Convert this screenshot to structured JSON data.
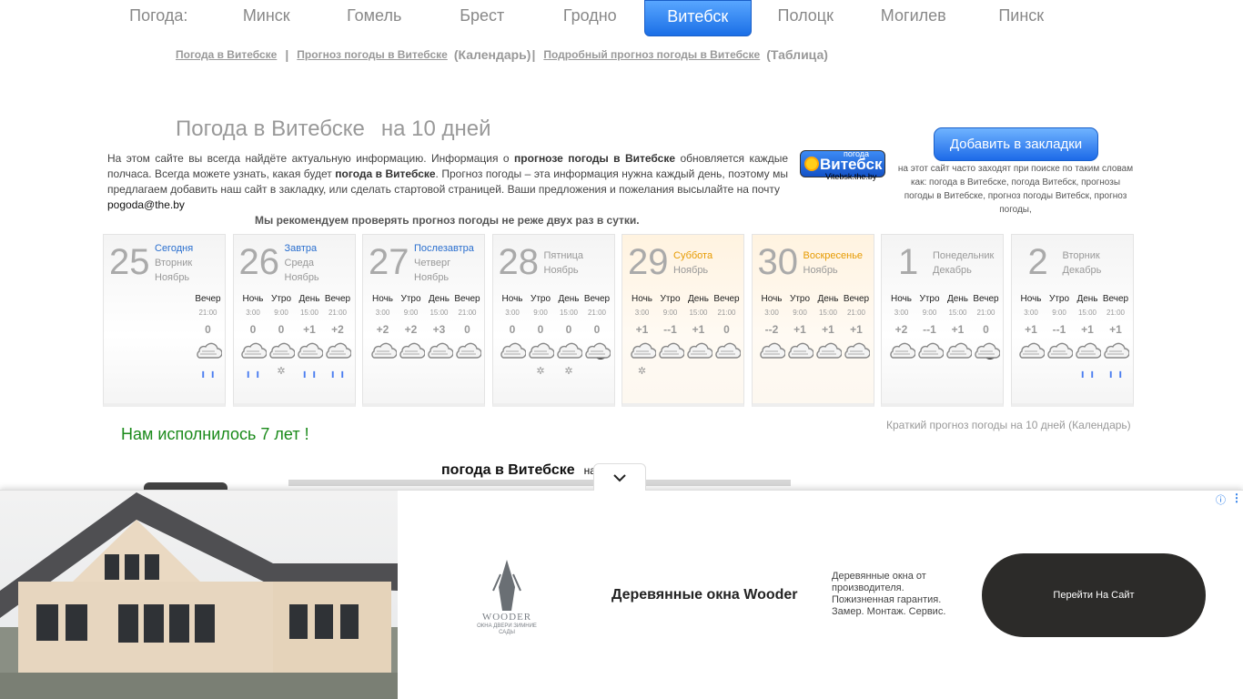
{
  "nav": {
    "label": "Погода:",
    "cities": [
      "Минск",
      "Гомель",
      "Брест",
      "Гродно",
      "Витебск",
      "Полоцк",
      "Могилев",
      "Пинск"
    ],
    "active": "Витебск"
  },
  "sublinks": {
    "link1": "Погода в Витебске",
    "sep1": "|",
    "link2": "Прогноз погоды в Витебске",
    "paren2": "(Календарь)",
    "sep2": "|",
    "link3": "Подробный прогноз погоды в Витебске",
    "paren3": "(Таблица)"
  },
  "heading": {
    "title": "Погода в Витебске",
    "period": "на 10 дней"
  },
  "intro": {
    "p1": "На этом сайте вы всегда найдёте актуальную информацию. Информация о ",
    "b1": "прогнозе погоды в Витебске",
    "p2": " обновляется каждые полчаса. Всегда можете узнать, какая будет ",
    "b2": "погода в Витебске",
    "p3": ". Прогноз погоды – эта информация нужна каждый день, поэтому мы предлагаем добавить наш сайт в закладку, или сделать стартовой страницей. Ваши предложения и пожелания высылайте на почту",
    "email": "pogoda@the.by",
    "recommend": "Мы рекомендуем проверять прогноз погоды не реже двух раз в сутки."
  },
  "logo": {
    "top": "погода",
    "city": "Витебск",
    "domain": "Vitebsk.the.by"
  },
  "bookmark_label": "Добавить в закладки",
  "search_tags": "на этот сайт часто заходят при поиске по таким словам как: погода в Витебске, погода Витебск, прогнозы погоды в Витебске, прогноз погоды Витебск, прогноз погоды,",
  "periods": [
    "Ночь",
    "Утро",
    "День",
    "Вечер"
  ],
  "hours": [
    "3:00",
    "9:00",
    "15:00",
    "21:00"
  ],
  "days": [
    {
      "num": "25",
      "l1": "Сегодня",
      "l2": "Вторник",
      "l3": "Ноябрь",
      "type": "link",
      "cols": [
        {
          "p": "Вечер",
          "h": "21:00",
          "t": "0",
          "icon": "cloud",
          "pr": "rain"
        }
      ]
    },
    {
      "num": "26",
      "l1": "Завтра",
      "l2": "Среда",
      "l3": "Ноябрь",
      "type": "link",
      "cols": [
        {
          "p": "Ночь",
          "h": "3:00",
          "t": "0",
          "icon": "cloud",
          "pr": "rain"
        },
        {
          "p": "Утро",
          "h": "9:00",
          "t": "0",
          "icon": "cloud",
          "pr": "snow"
        },
        {
          "p": "День",
          "h": "15:00",
          "t": "+1",
          "icon": "cloud",
          "pr": "rain"
        },
        {
          "p": "Вечер",
          "h": "21:00",
          "t": "+2",
          "icon": "cloud",
          "pr": "rain"
        }
      ]
    },
    {
      "num": "27",
      "l1": "Послезавтра",
      "l2": "Четверг",
      "l3": "Ноябрь",
      "type": "link",
      "cols": [
        {
          "p": "Ночь",
          "h": "3:00",
          "t": "+2",
          "icon": "cloud",
          "pr": ""
        },
        {
          "p": "Утро",
          "h": "9:00",
          "t": "+2",
          "icon": "cloud",
          "pr": ""
        },
        {
          "p": "День",
          "h": "15:00",
          "t": "+3",
          "icon": "cloud",
          "pr": ""
        },
        {
          "p": "Вечер",
          "h": "21:00",
          "t": "0",
          "icon": "cloud",
          "pr": ""
        }
      ]
    },
    {
      "num": "28",
      "l1": "",
      "l2": "Пятница",
      "l3": "Ноябрь",
      "type": "plain",
      "cols": [
        {
          "p": "Ночь",
          "h": "3:00",
          "t": "0",
          "icon": "cloud",
          "pr": ""
        },
        {
          "p": "Утро",
          "h": "9:00",
          "t": "0",
          "icon": "cloud",
          "pr": "snow"
        },
        {
          "p": "День",
          "h": "15:00",
          "t": "0",
          "icon": "suncloud",
          "pr": "snow"
        },
        {
          "p": "Вечер",
          "h": "21:00",
          "t": "0",
          "icon": "mooncloud",
          "pr": ""
        }
      ]
    },
    {
      "num": "29",
      "l1": "",
      "l2": "Суббота",
      "l3": "Ноябрь",
      "type": "weekend",
      "cols": [
        {
          "p": "Ночь",
          "h": "3:00",
          "t": "+1",
          "icon": "cloud",
          "pr": "snow"
        },
        {
          "p": "Утро",
          "h": "9:00",
          "t": "--1",
          "icon": "cloud",
          "pr": ""
        },
        {
          "p": "День",
          "h": "15:00",
          "t": "+1",
          "icon": "cloud",
          "pr": ""
        },
        {
          "p": "Вечер",
          "h": "21:00",
          "t": "0",
          "icon": "cloud",
          "pr": ""
        }
      ]
    },
    {
      "num": "30",
      "l1": "",
      "l2": "Воскресенье",
      "l3": "Ноябрь",
      "type": "weekend",
      "cols": [
        {
          "p": "Ночь",
          "h": "3:00",
          "t": "--2",
          "icon": "cloud",
          "pr": ""
        },
        {
          "p": "Утро",
          "h": "9:00",
          "t": "+1",
          "icon": "suncloud",
          "pr": ""
        },
        {
          "p": "День",
          "h": "15:00",
          "t": "+1",
          "icon": "cloud",
          "pr": ""
        },
        {
          "p": "Вечер",
          "h": "21:00",
          "t": "+1",
          "icon": "cloud",
          "pr": ""
        }
      ]
    },
    {
      "num": "1",
      "l1": "",
      "l2": "Понедельник",
      "l3": "Декабрь",
      "type": "plain",
      "cols": [
        {
          "p": "Ночь",
          "h": "3:00",
          "t": "+2",
          "icon": "cloud",
          "pr": ""
        },
        {
          "p": "Утро",
          "h": "9:00",
          "t": "--1",
          "icon": "suncloud",
          "pr": ""
        },
        {
          "p": "День",
          "h": "15:00",
          "t": "+1",
          "icon": "suncloud",
          "pr": ""
        },
        {
          "p": "Вечер",
          "h": "21:00",
          "t": "0",
          "icon": "mooncloud",
          "pr": ""
        }
      ]
    },
    {
      "num": "2",
      "l1": "",
      "l2": "Вторник",
      "l3": "Декабрь",
      "type": "plain",
      "cols": [
        {
          "p": "Ночь",
          "h": "3:00",
          "t": "+1",
          "icon": "cloud",
          "pr": ""
        },
        {
          "p": "Утро",
          "h": "9:00",
          "t": "--1",
          "icon": "suncloud",
          "pr": ""
        },
        {
          "p": "День",
          "h": "15:00",
          "t": "+1",
          "icon": "suncloud",
          "pr": "rain"
        },
        {
          "p": "Вечер",
          "h": "21:00",
          "t": "+1",
          "icon": "cloud",
          "pr": "rain"
        }
      ]
    }
  ],
  "birthday": "Нам исполнилось 7 лет !",
  "calendar_note": "Краткий прогноз погоды на 10 дней (Календарь)",
  "subhead": {
    "title": "погода в Витебске",
    "tail": "на"
  },
  "ad": {
    "title": "Деревянные окна Wooder",
    "text": "Деревянные окна от производителя. Пожизненная гарантия. Замер. Монтаж. Сервис.",
    "cta": "Перейти На Сайт",
    "brand": "WOODER",
    "brand_sub": "ОКНА ДВЕРИ ЗИМНИЕ САДЫ",
    "info_icon": "info-icon",
    "menu_icon": "kebab-menu-icon"
  },
  "colors": {
    "accent": "#1b6fe6",
    "link": "#2a6fcf",
    "weekend": "#e69a00",
    "birthday": "#1a8a1a",
    "cta_bg": "#2c2b29"
  }
}
